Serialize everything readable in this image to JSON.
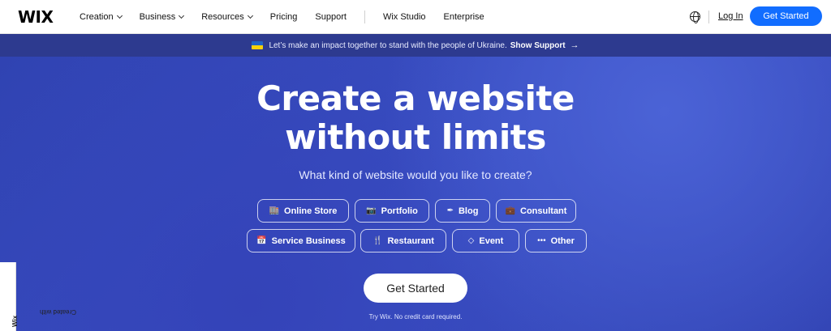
{
  "header": {
    "logo": "WIX",
    "nav": [
      {
        "label": "Creation",
        "dropdown": true
      },
      {
        "label": "Business",
        "dropdown": true
      },
      {
        "label": "Resources",
        "dropdown": true
      },
      {
        "label": "Pricing",
        "dropdown": false
      },
      {
        "label": "Support",
        "dropdown": false
      }
    ],
    "nav_secondary": [
      "Wix Studio",
      "Enterprise"
    ],
    "login": "Log In",
    "cta": "Get Started",
    "globe_icon": "globe-icon"
  },
  "banner": {
    "text": "Let’s make an impact together to stand with the people of Ukraine.",
    "link": "Show Support",
    "arrow": "→",
    "flag_icon": "ukraine-flag-icon"
  },
  "hero": {
    "headline_1": "Create a website",
    "headline_2": "without limits",
    "subhead": "What kind of website would you like to create?",
    "categories_row1": [
      {
        "label": "Online Store",
        "icon": "store-icon",
        "glyph": "🏬"
      },
      {
        "label": "Portfolio",
        "icon": "camera-icon",
        "glyph": "📷"
      },
      {
        "label": "Blog",
        "icon": "pen-icon",
        "glyph": "✒"
      },
      {
        "label": "Consultant",
        "icon": "briefcase-icon",
        "glyph": "💼"
      }
    ],
    "categories_row2": [
      {
        "label": "Service Business",
        "icon": "calendar-icon",
        "glyph": "📅"
      },
      {
        "label": "Restaurant",
        "icon": "utensils-icon",
        "glyph": "🍴"
      },
      {
        "label": "Event",
        "icon": "ticket-icon",
        "glyph": "◇"
      },
      {
        "label": "Other",
        "icon": "more-icon",
        "glyph": "•••"
      }
    ],
    "cta": "Get Started",
    "note": "Try Wix. No credit card required."
  },
  "badge": {
    "prefix": "Created with ",
    "brand": "Wix"
  },
  "colors": {
    "primary": "#116dff",
    "banner": "#2d3a8f",
    "hero": "#3a4fc4"
  }
}
